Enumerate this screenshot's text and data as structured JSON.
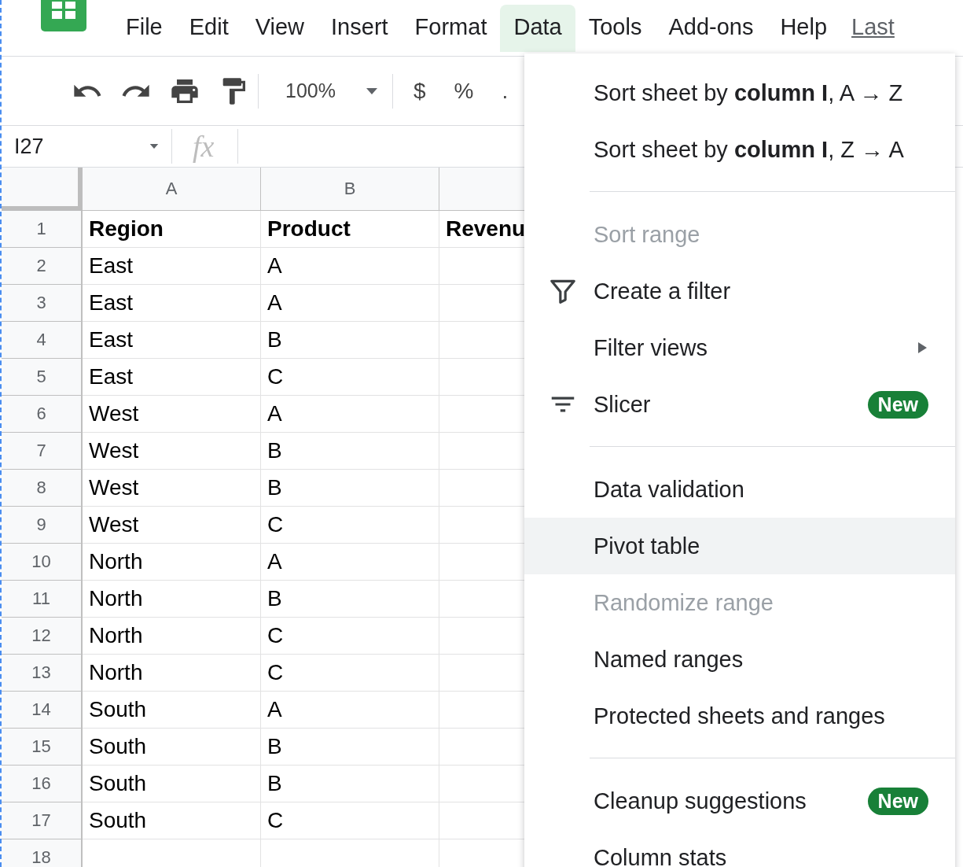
{
  "menu_bar": {
    "items": [
      {
        "label": "File",
        "selected": false
      },
      {
        "label": "Edit",
        "selected": false
      },
      {
        "label": "View",
        "selected": false
      },
      {
        "label": "Insert",
        "selected": false
      },
      {
        "label": "Format",
        "selected": false
      },
      {
        "label": "Data",
        "selected": true
      },
      {
        "label": "Tools",
        "selected": false
      },
      {
        "label": "Add-ons",
        "selected": false
      },
      {
        "label": "Help",
        "selected": false
      }
    ],
    "last_edit": "Last"
  },
  "toolbar": {
    "zoom": "100%",
    "currency": "$",
    "percent": "%",
    "decimal": "."
  },
  "formula_bar": {
    "cell_ref": "I27",
    "fx": "fx"
  },
  "sheet": {
    "columns": [
      "A",
      "B"
    ],
    "rows": [
      {
        "number": "1",
        "cells": [
          "Region",
          "Product",
          "Revenu"
        ],
        "header": true
      },
      {
        "number": "2",
        "cells": [
          "East",
          "A"
        ],
        "header": false
      },
      {
        "number": "3",
        "cells": [
          "East",
          "A"
        ],
        "header": false
      },
      {
        "number": "4",
        "cells": [
          "East",
          "B"
        ],
        "header": false
      },
      {
        "number": "5",
        "cells": [
          "East",
          "C"
        ],
        "header": false
      },
      {
        "number": "6",
        "cells": [
          "West",
          "A"
        ],
        "header": false
      },
      {
        "number": "7",
        "cells": [
          "West",
          "B"
        ],
        "header": false
      },
      {
        "number": "8",
        "cells": [
          "West",
          "B"
        ],
        "header": false
      },
      {
        "number": "9",
        "cells": [
          "West",
          "C"
        ],
        "header": false
      },
      {
        "number": "10",
        "cells": [
          "North",
          "A"
        ],
        "header": false
      },
      {
        "number": "11",
        "cells": [
          "North",
          "B"
        ],
        "header": false
      },
      {
        "number": "12",
        "cells": [
          "North",
          "C"
        ],
        "header": false
      },
      {
        "number": "13",
        "cells": [
          "North",
          "C"
        ],
        "header": false
      },
      {
        "number": "14",
        "cells": [
          "South",
          "A"
        ],
        "header": false
      },
      {
        "number": "15",
        "cells": [
          "South",
          "B"
        ],
        "header": false
      },
      {
        "number": "16",
        "cells": [
          "South",
          "B"
        ],
        "header": false
      },
      {
        "number": "17",
        "cells": [
          "South",
          "C"
        ],
        "header": false
      },
      {
        "number": "18",
        "cells": []
      }
    ]
  },
  "data_menu": {
    "items": [
      {
        "kind": "plain",
        "label": "Sort sheet by **column I**, A → Z",
        "disabled": false,
        "highlighted": false
      },
      {
        "kind": "plain",
        "label": "Sort sheet by **column I**, Z → A",
        "disabled": false,
        "highlighted": false
      },
      {
        "kind": "divider"
      },
      {
        "kind": "plain",
        "label": "Sort range",
        "disabled": true,
        "highlighted": false
      },
      {
        "kind": "filter",
        "label": "Create a filter",
        "disabled": false,
        "highlighted": false
      },
      {
        "kind": "submenu",
        "label": "Filter views",
        "disabled": false,
        "highlighted": false
      },
      {
        "kind": "slicer",
        "label": "Slicer",
        "badge": "New",
        "disabled": false,
        "highlighted": false
      },
      {
        "kind": "divider"
      },
      {
        "kind": "plain",
        "label": "Data validation",
        "disabled": false,
        "highlighted": false
      },
      {
        "kind": "plain",
        "label": "Pivot table",
        "disabled": false,
        "highlighted": true
      },
      {
        "kind": "plain",
        "label": "Randomize range",
        "disabled": true,
        "highlighted": false
      },
      {
        "kind": "plain",
        "label": "Named ranges",
        "disabled": false,
        "highlighted": false
      },
      {
        "kind": "plain",
        "label": "Protected sheets and ranges",
        "disabled": false,
        "highlighted": false
      },
      {
        "kind": "divider"
      },
      {
        "kind": "plain",
        "label": "Cleanup suggestions",
        "badge": "New",
        "disabled": false,
        "highlighted": false
      },
      {
        "kind": "plain",
        "label": "Column stats",
        "disabled": false,
        "highlighted": false
      }
    ]
  }
}
